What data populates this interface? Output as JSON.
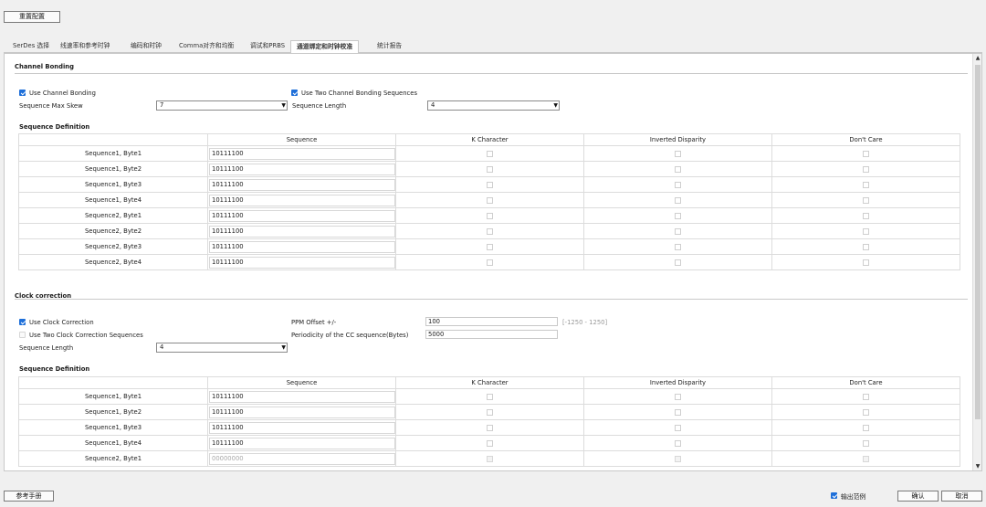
{
  "toolbar": {
    "reset_label": "重置配置"
  },
  "tabs": [
    {
      "label": "SerDes 选择"
    },
    {
      "label": "线速率和参考时钟"
    },
    {
      "label": "编码和时钟"
    },
    {
      "label": "Comma对齐和均衡"
    },
    {
      "label": "调试和PRBS"
    },
    {
      "label": "通道绑定和时钟校准"
    },
    {
      "label": "统计报告"
    }
  ],
  "channel_bonding": {
    "title": "Channel Bonding",
    "use_bonding_label": "Use Channel Bonding",
    "use_two_label": "Use Two Channel Bonding Sequences",
    "max_skew_label": "Sequence Max Skew",
    "max_skew_value": "7",
    "seq_length_label": "Sequence Length",
    "seq_length_value": "4",
    "seq_def_title": "Sequence Definition",
    "columns": [
      "Sequence",
      "K Character",
      "Inverted Disparity",
      "Don't Care"
    ],
    "rows": [
      {
        "label": "Sequence1, Byte1",
        "seq": "10111100"
      },
      {
        "label": "Sequence1, Byte2",
        "seq": "10111100"
      },
      {
        "label": "Sequence1, Byte3",
        "seq": "10111100"
      },
      {
        "label": "Sequence1, Byte4",
        "seq": "10111100"
      },
      {
        "label": "Sequence2, Byte1",
        "seq": "10111100"
      },
      {
        "label": "Sequence2, Byte2",
        "seq": "10111100"
      },
      {
        "label": "Sequence2, Byte3",
        "seq": "10111100"
      },
      {
        "label": "Sequence2, Byte4",
        "seq": "10111100"
      }
    ]
  },
  "clock_correction": {
    "title": "Clock correction",
    "use_cc_label": "Use Clock Correction",
    "use_two_label": "Use Two Clock Correction Sequences",
    "seq_length_label": "Sequence Length",
    "seq_length_value": "4",
    "ppm_label": "PPM Offset +/-",
    "ppm_value": "100",
    "ppm_range": "[-1250 - 1250]",
    "period_label": "Periodicity of the CC sequence(Bytes)",
    "period_value": "5000",
    "seq_def_title": "Sequence Definition",
    "columns": [
      "Sequence",
      "K Character",
      "Inverted Disparity",
      "Don't Care"
    ],
    "rows": [
      {
        "label": "Sequence1, Byte1",
        "seq": "10111100"
      },
      {
        "label": "Sequence1, Byte2",
        "seq": "10111100"
      },
      {
        "label": "Sequence1, Byte3",
        "seq": "10111100"
      },
      {
        "label": "Sequence1, Byte4",
        "seq": "10111100"
      },
      {
        "label": "Sequence2, Byte1",
        "seq": "00000000"
      }
    ]
  },
  "footer": {
    "manual_label": "参考手册",
    "example_label": "输出范例",
    "ok_label": "确认",
    "cancel_label": "取消"
  },
  "colors": {
    "accent": "#1e6fd9"
  }
}
